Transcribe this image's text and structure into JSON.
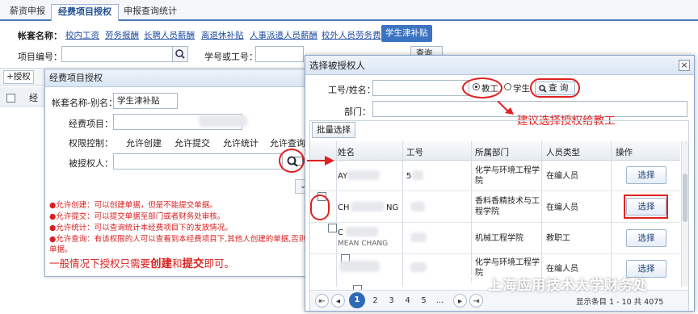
{
  "top_tabs": [
    "薪资申报",
    "经费项目授权",
    "申报查询统计"
  ],
  "account_row": {
    "label": "帐套名称：",
    "items": [
      "校内工资",
      "劳务报酬",
      "长聘人员薪酬",
      "离退休补贴",
      "人事派遣人员薪酬",
      "校外人员劳务费"
    ],
    "active": "学生津补贴"
  },
  "search": {
    "project_label": "项目编号：",
    "id_label": "学号或工号：",
    "query_btn": "查询"
  },
  "toolbar": {
    "add_auth": "+授权"
  },
  "left_table": {
    "col_jing": "经"
  },
  "left_dialog": {
    "title": "经费项目授权",
    "account_alias_label": "帐套名称-别名：",
    "account_alias_value": "学生津补贴",
    "project_label": "经费项目：",
    "perm_label": "权限控制：",
    "perm_options": [
      {
        "label": "允许创建",
        "checked": true
      },
      {
        "label": "允许提交",
        "checked": true
      },
      {
        "label": "允许统计",
        "checked": false
      },
      {
        "label": "允许查询",
        "checked": false
      }
    ],
    "authorized_label": "被授权人：",
    "notes": [
      "●允许创建：可以创建单据，但是不能提交单据。",
      "●允许提交：可以提交单据至部门或者财务处审核。",
      "●允许统计：可以查询统计本经费项目下的发放情况。",
      "●允许查询：有该权限的人可以查看到本经费项目下,其他人创建的单据,否则",
      "单据。"
    ],
    "big_tip_1": "一般情况下授权只需要",
    "big_tip_create": "创建",
    "big_tip_and": "和",
    "big_tip_submit": "提交",
    "big_tip_end": "即可。"
  },
  "right_dialog": {
    "title": "选择被授权人",
    "id_name_label": "工号/姓名：",
    "radio_staff": "教工",
    "radio_student": "学生",
    "query_btn": "查 询",
    "dept_label": "部门：",
    "batch_btn": "批量选择",
    "columns": [
      "姓名",
      "工号",
      "所属部门",
      "人员类型",
      "操作"
    ],
    "rows": [
      {
        "name": "AY",
        "id": "5",
        "dept": "化学与环境工程学院",
        "type": "在编人员",
        "action": "选择"
      },
      {
        "name": "CH",
        "name_tail": "NG",
        "id": "",
        "dept": "香料香精技术与工程学院",
        "type": "在编人员",
        "action": "选择"
      },
      {
        "name": "C",
        "name_line2": "MEAN CHANG",
        "id": "",
        "dept": "机械工程学院",
        "type": "教职工",
        "action": "选择"
      },
      {
        "name": "",
        "id": "",
        "dept": "化学与环境工程学院",
        "type": "在编人员",
        "action": "选择"
      }
    ],
    "pagination": {
      "pages": [
        "1",
        "2",
        "3",
        "4",
        "5"
      ],
      "current": "1",
      "ellipsis": "...",
      "info": "显示条目 1 - 10 共 4075"
    }
  },
  "annotation": {
    "tip": "建议选择授权给教工"
  },
  "watermark": "上海应用技术大学财务处"
}
